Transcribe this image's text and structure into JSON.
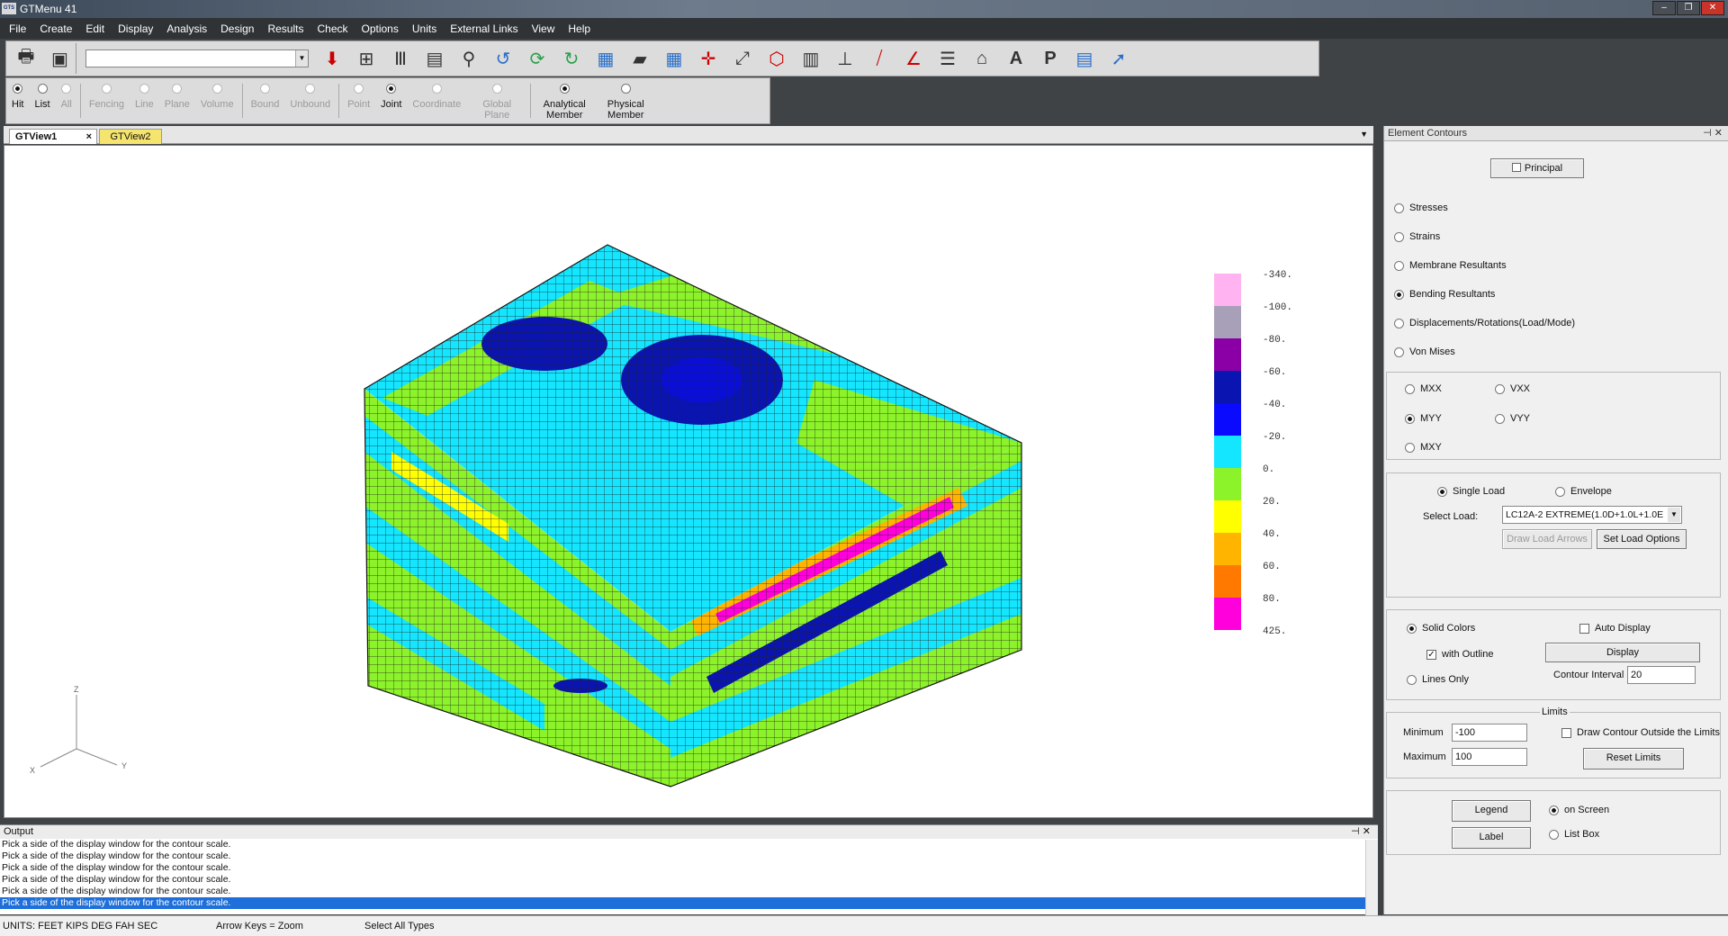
{
  "app": {
    "title": "GTMenu 41",
    "logo": "GTS"
  },
  "menu": [
    "File",
    "Create",
    "Edit",
    "Display",
    "Analysis",
    "Design",
    "Results",
    "Check",
    "Options",
    "Units",
    "External Links",
    "View",
    "Help"
  ],
  "toolbar": {
    "combo_value": ""
  },
  "selection_modes": [
    {
      "label": "Hit",
      "selected": true,
      "enabled": true
    },
    {
      "label": "List",
      "selected": false,
      "enabled": true
    },
    {
      "label": "All",
      "selected": false,
      "enabled": false
    },
    {
      "label": "Fencing",
      "selected": false,
      "enabled": false
    },
    {
      "label": "Line",
      "selected": false,
      "enabled": false
    },
    {
      "label": "Plane",
      "selected": false,
      "enabled": false
    },
    {
      "label": "Volume",
      "selected": false,
      "enabled": false
    },
    {
      "label": "Bound",
      "selected": false,
      "enabled": false
    },
    {
      "label": "Unbound",
      "selected": false,
      "enabled": false
    },
    {
      "label": "Point",
      "selected": false,
      "enabled": false
    },
    {
      "label": "Joint",
      "selected": true,
      "enabled": true
    },
    {
      "label": "Coordinate",
      "selected": false,
      "enabled": false
    },
    {
      "label": "Global Plane",
      "selected": false,
      "enabled": false
    },
    {
      "label": "Analytical Member",
      "selected": true,
      "enabled": true
    },
    {
      "label": "Physical Member",
      "selected": false,
      "enabled": true
    }
  ],
  "tabs": [
    {
      "label": "GTView1",
      "close": "×"
    },
    {
      "label": "GTView2"
    }
  ],
  "contour_legend": {
    "labels": [
      "-340.",
      "-100.",
      "-80.",
      "-60.",
      "-40.",
      "-20.",
      "0.",
      "20.",
      "40.",
      "60.",
      "80.",
      "425."
    ],
    "colors": [
      "#ffb3f0",
      "#a8a0b8",
      "#8a00a6",
      "#0a14b0",
      "#0a0aff",
      "#14e6ff",
      "#8cf22a",
      "#ffff00",
      "#ffb400",
      "#ff7800",
      "#ff00dc"
    ]
  },
  "axes": {
    "z": "Z",
    "x": "X",
    "y": "Y"
  },
  "panel": {
    "title": "Element Contours",
    "principal": "Principal",
    "result_types": [
      {
        "label": "Stresses",
        "selected": false
      },
      {
        "label": "Strains",
        "selected": false
      },
      {
        "label": "Membrane Resultants",
        "selected": false
      },
      {
        "label": "Bending Resultants",
        "selected": true
      },
      {
        "label": "Displacements/Rotations(Load/Mode)",
        "selected": false
      },
      {
        "label": "Von Mises",
        "selected": false
      }
    ],
    "components": [
      {
        "label": "MXX",
        "selected": false
      },
      {
        "label": "VXX",
        "selected": false
      },
      {
        "label": "MYY",
        "selected": true
      },
      {
        "label": "VYY",
        "selected": false
      },
      {
        "label": "MXY",
        "selected": false
      }
    ],
    "load_mode": {
      "single": "Single Load",
      "envelope": "Envelope",
      "single_selected": true
    },
    "select_load_label": "Select Load:",
    "select_load_value": "LC12A-2  EXTREME(1.0D+1.0L+1.0E",
    "draw_load_arrows": "Draw Load Arrows",
    "set_load_options": "Set Load Options",
    "solid_colors": "Solid Colors",
    "with_outline": "with Outline",
    "lines_only": "Lines Only",
    "auto_display": "Auto Display",
    "display": "Display",
    "contour_interval_label": "Contour Interval",
    "contour_interval": "20",
    "limits_title": "Limits",
    "minimum_label": "Minimum",
    "minimum": "-100",
    "maximum_label": "Maximum",
    "maximum": "100",
    "draw_outside": "Draw Contour Outside the Limits",
    "reset_limits": "Reset Limits",
    "legend": "Legend",
    "label": "Label",
    "on_screen": "on Screen",
    "list_box": "List Box"
  },
  "output": {
    "title": "Output",
    "lines": [
      "Pick a side of the display window for the contour scale.",
      "Pick a side of the display window for the contour scale.",
      "Pick a side of the display window for the contour scale.",
      "Pick a side of the display window for the contour scale.",
      "Pick a side of the display window for the contour scale.",
      "Pick a side of the display window for the contour scale."
    ]
  },
  "status": {
    "units": "UNITS:  FEET  KIPS  DEG    FAH   SEC",
    "hint": "Arrow Keys = Zoom",
    "mode": "Select All Types"
  }
}
